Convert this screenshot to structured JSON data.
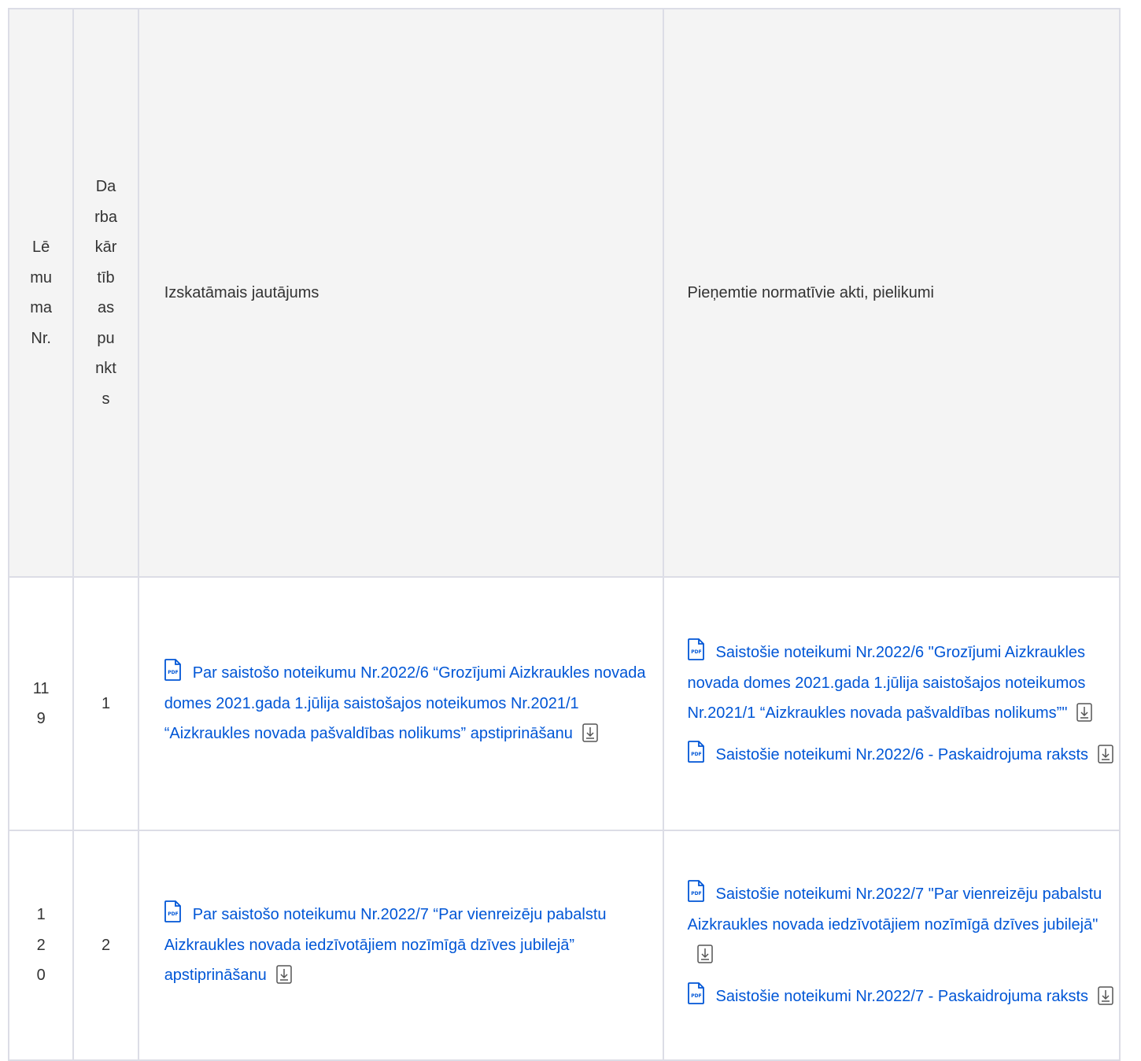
{
  "table": {
    "headers": {
      "decision_no": "Lēmuma Nr.",
      "agenda_item": "Darbakārtības punkts",
      "question": "Izskatāmais jautājums",
      "acts": "Pieņemtie normatīvie akti, pielikumi"
    },
    "rows": [
      {
        "decision_no": "119",
        "agenda_item": "1",
        "question": "Par saistošo noteikumu Nr.2022/6 “Grozījumi Aizkraukles novada domes 2021.gada 1.jūlija saistošajos noteikumos Nr.2021/1 “Aizkraukles novada pašvaldības nolikums” apstiprināšanu",
        "acts": [
          "Saistošie noteikumi Nr.2022/6 \"Grozījumi Aizkraukles novada domes 2021.gada 1.jūlija saistošajos noteikumos Nr.2021/1 “Aizkraukles novada pašvaldības nolikums”\"",
          "Saistošie noteikumi Nr.2022/6 - Paskaidrojuma raksts"
        ]
      },
      {
        "decision_no": "120",
        "agenda_item": "2",
        "question": "Par saistošo noteikumu Nr.2022/7 “Par vienreizēju pabalstu Aizkraukles novada iedzīvotājiem nozīmīgā dzīves jubilejā” apstiprināšanu",
        "acts": [
          "Saistošie noteikumi Nr.2022/7 \"Par vienreizēju pabalstu Aizkraukles novada iedzīvotājiem nozīmīgā dzīves jubilejā\"",
          "Saistošie noteikumi Nr.2022/7 - Paskaidrojuma raksts"
        ]
      }
    ]
  },
  "icons": {
    "pdf": "pdf-file-icon",
    "download": "download-icon"
  },
  "colors": {
    "link": "#0056d6",
    "border": "#dcdde6",
    "header_bg": "#f4f4f4"
  }
}
